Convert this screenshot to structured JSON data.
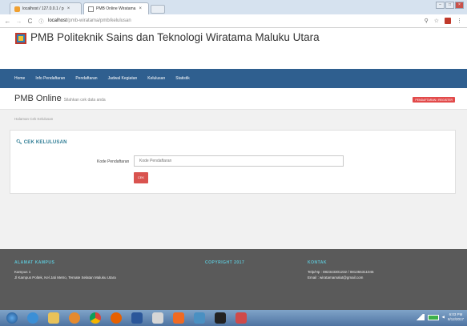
{
  "browser": {
    "tabs": [
      {
        "label": "localhost / 127.0.0.1 / p",
        "close": "×"
      },
      {
        "label": "PMB Online Wiratama",
        "close": "×"
      }
    ],
    "window_buttons": [
      "–",
      "□",
      "×"
    ],
    "url_host": "localhost",
    "url_path": "/pmb-wiratama/pmb/kelulusan",
    "nav": {
      "back": "←",
      "forward": "→",
      "reload": "C",
      "info": "ⓘ"
    }
  },
  "site": {
    "title": "PMB Politeknik Sains dan Teknologi Wiratama Maluku Utara",
    "nav_items": [
      "Home",
      "Info Pendaftaran",
      "Pendaftaran",
      "Jadwal Kegiatan",
      "Kelulusan",
      "Statistik"
    ]
  },
  "page": {
    "title": "PMB Online",
    "subtitle": "Silahkan cek data anda",
    "register_button": "PENDAFTARAN / REGISTER",
    "breadcrumb": "Halaman Cek Kelulusan"
  },
  "card": {
    "title": "CEK KELULUSAN",
    "field_label": "Kode Pendaftaran",
    "field_placeholder": "Kode Pendaftaran",
    "field_value": "",
    "button": "CEK"
  },
  "footer": {
    "col1_head": "ALAMAT KAMPUS",
    "col1_line1": "Kampus 1",
    "col1_line2": "Jl Kampus Poltek, Kel Jati Metro, Ternate Selatan Maluku Utara",
    "col2_head": "COPYRIGHT 2017",
    "col3_head": "KONTAK",
    "col3_line1": "Telp/Hp : 082343301232 / 081355311045",
    "col3_line2": "Email : wiratamamalut@gmail.com"
  },
  "taskbar": {
    "time": "6:03 PM",
    "date": "8/12/2017"
  },
  "colors": {
    "navbar": "#2f5f8f",
    "accent_red": "#d9534f",
    "footer": "#5a5a5a",
    "footer_head": "#5ec3d3"
  }
}
